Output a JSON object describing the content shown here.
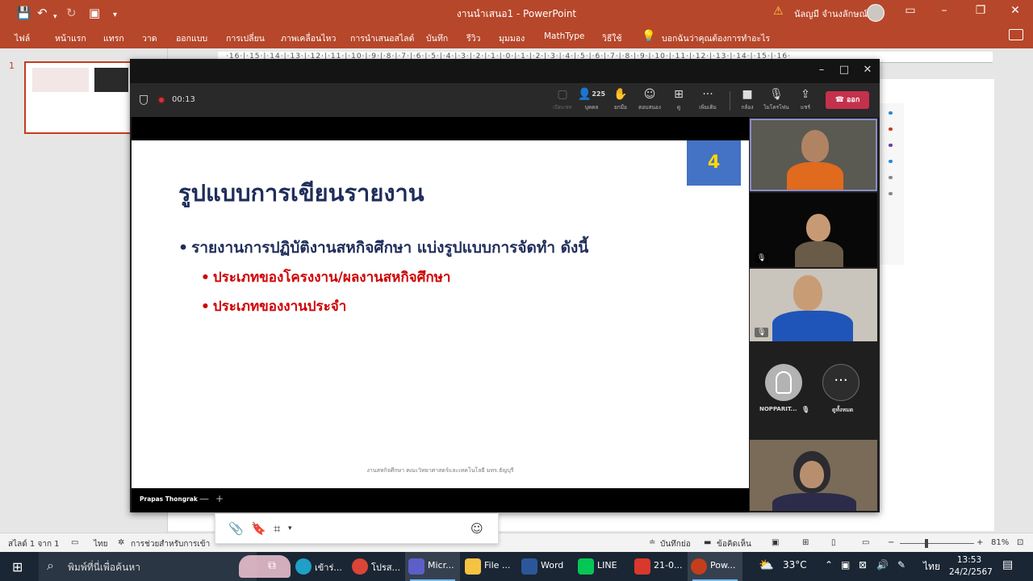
{
  "ppt": {
    "title": "งานนำเสนอ1  -  PowerPoint",
    "user_name": "นัลญมี จำนงลักษณ์",
    "tabs": [
      "ไฟล์",
      "หน้าแรก",
      "แทรก",
      "วาด",
      "ออกแบบ",
      "การเปลี่ยน",
      "ภาพเคลื่อนไหว",
      "การนำเสนอสไลด์",
      "บันทึก",
      "รีวิว",
      "มุมมอง",
      "MathType",
      "วิธีใช้"
    ],
    "tell_me": "บอกฉันว่าคุณต้องการทำอะไร",
    "slide_number": "1",
    "ruler": "·16·|·15·|·14·|·13·|·12·|·11·|·10·|·9·|·8·|·7·|·6·|·5·|·4·|·3·|·2·|·1·|·0·|·1·|·2·|·3·|·4·|·5·|·6·|·7·|·8·|·9·|·10·|·11·|·12·|·13·|·14·|·15·|·16·",
    "status": {
      "slide_of": "สไลด์ 1 จาก 1",
      "language": "ไทย",
      "accessibility": "การช่วยสำหรับการเข้า",
      "notes": "บันทึกย่อ",
      "comments": "ข้อคิดเห็น",
      "zoom": "81%",
      "zoom_fraction": 0.36
    }
  },
  "teams": {
    "timer": "00:13",
    "participant_count": "225",
    "controls": {
      "chat": "เปิดแชท",
      "people": "บุคคล",
      "raise": "ยกมือ",
      "react": "ตอบสนอง",
      "view": "ดู",
      "more": "เพิ่มเติม",
      "camera": "กล้อง",
      "mic": "ไมโครโฟน",
      "share": "แชร์",
      "leave": "ออก"
    },
    "presenter": "Prapas Thongrak",
    "participants": {
      "name_1": "NOPPARIT...",
      "more_label": "ดูทั้งหมด"
    }
  },
  "slide": {
    "number": "4",
    "title": "รูปแบบการเขียนรายงาน",
    "bullet": "รายงานการปฏิบัติงานสหกิจศึกษา แบ่งรูปแบบการจัดทำ ดังนี้",
    "sub_bullets": [
      "ประเภทของโครงงาน/ผลงานสหกิจศึกษา",
      "ประเภทของงานประจำ"
    ],
    "footer": "งานสหกิจศึกษา คณะวิทยาศาสตร์และเทคโนโลยี มทร.ธัญบุรี"
  },
  "taskbar": {
    "search": "พิมพ์ที่นี่เพื่อค้นหา",
    "apps": [
      "เข้าร่...",
      "โปรส...",
      "Micr...",
      "File ...",
      "Word",
      "LINE",
      "21-0...",
      "Pow..."
    ],
    "temperature": "33°C",
    "ime": "ไทย",
    "time": "13:53",
    "date": "24/2/2567"
  },
  "colors": {
    "ppt_red": "#b7472a",
    "slide_title_navy": "#1f2d5a",
    "slide_red": "#d00000",
    "slide_num_bg": "#4472c4",
    "slide_num_fg": "#ffd700",
    "leave_red": "#c4314b"
  }
}
